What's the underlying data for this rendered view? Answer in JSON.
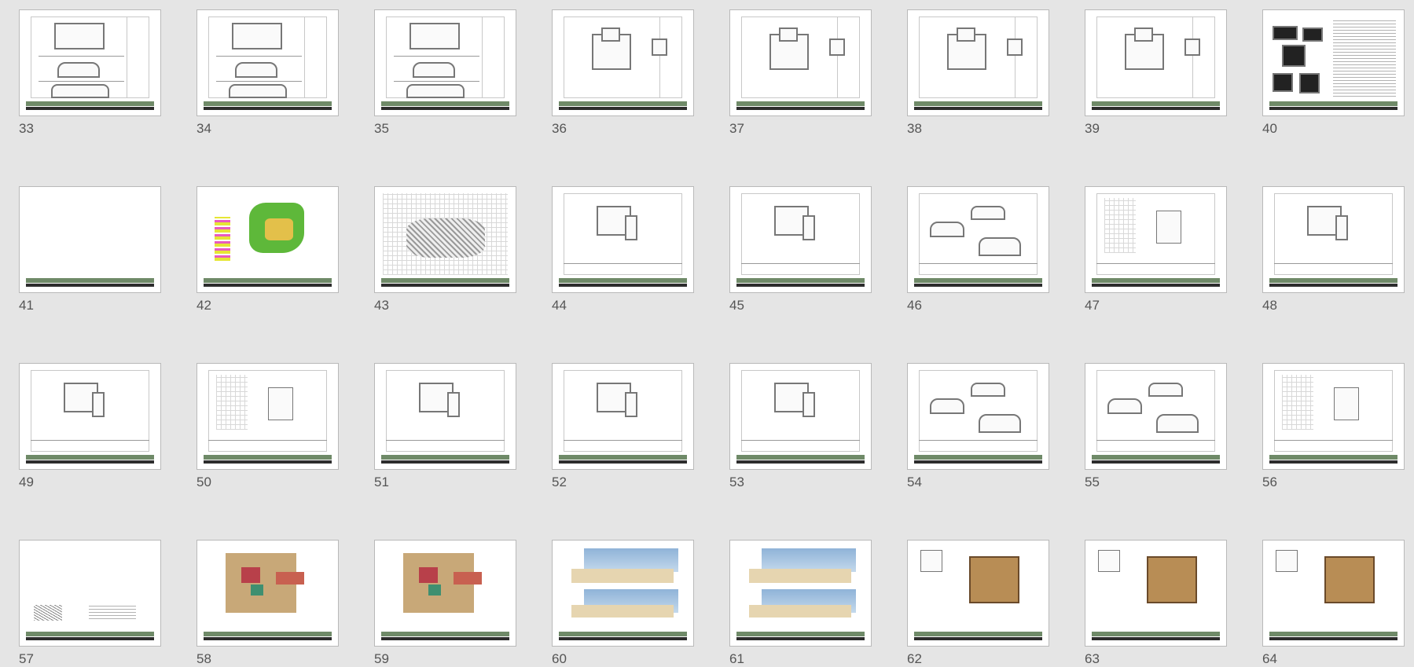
{
  "slides": [
    {
      "number": "33",
      "kind": "drawing"
    },
    {
      "number": "34",
      "kind": "drawing"
    },
    {
      "number": "35",
      "kind": "drawing"
    },
    {
      "number": "36",
      "kind": "plan"
    },
    {
      "number": "37",
      "kind": "plan"
    },
    {
      "number": "38",
      "kind": "plan"
    },
    {
      "number": "39",
      "kind": "plan"
    },
    {
      "number": "40",
      "kind": "text"
    },
    {
      "number": "41",
      "kind": "blank"
    },
    {
      "number": "42",
      "kind": "site-color"
    },
    {
      "number": "43",
      "kind": "site"
    },
    {
      "number": "44",
      "kind": "sheet"
    },
    {
      "number": "45",
      "kind": "sheet"
    },
    {
      "number": "46",
      "kind": "sections"
    },
    {
      "number": "47",
      "kind": "details"
    },
    {
      "number": "48",
      "kind": "sheet"
    },
    {
      "number": "49",
      "kind": "sheet"
    },
    {
      "number": "50",
      "kind": "details"
    },
    {
      "number": "51",
      "kind": "sheet"
    },
    {
      "number": "52",
      "kind": "sheet"
    },
    {
      "number": "53",
      "kind": "sheet"
    },
    {
      "number": "54",
      "kind": "sections"
    },
    {
      "number": "55",
      "kind": "sections"
    },
    {
      "number": "56",
      "kind": "details"
    },
    {
      "number": "57",
      "kind": "title"
    },
    {
      "number": "58",
      "kind": "color-plan"
    },
    {
      "number": "59",
      "kind": "color-plan"
    },
    {
      "number": "60",
      "kind": "render"
    },
    {
      "number": "61",
      "kind": "render"
    },
    {
      "number": "62",
      "kind": "interior"
    },
    {
      "number": "63",
      "kind": "interior"
    },
    {
      "number": "64",
      "kind": "interior"
    }
  ],
  "colors": {
    "background": "#e5e5e5",
    "footer_green": "#6f8a68",
    "footer_dark": "#2d2d2d"
  }
}
